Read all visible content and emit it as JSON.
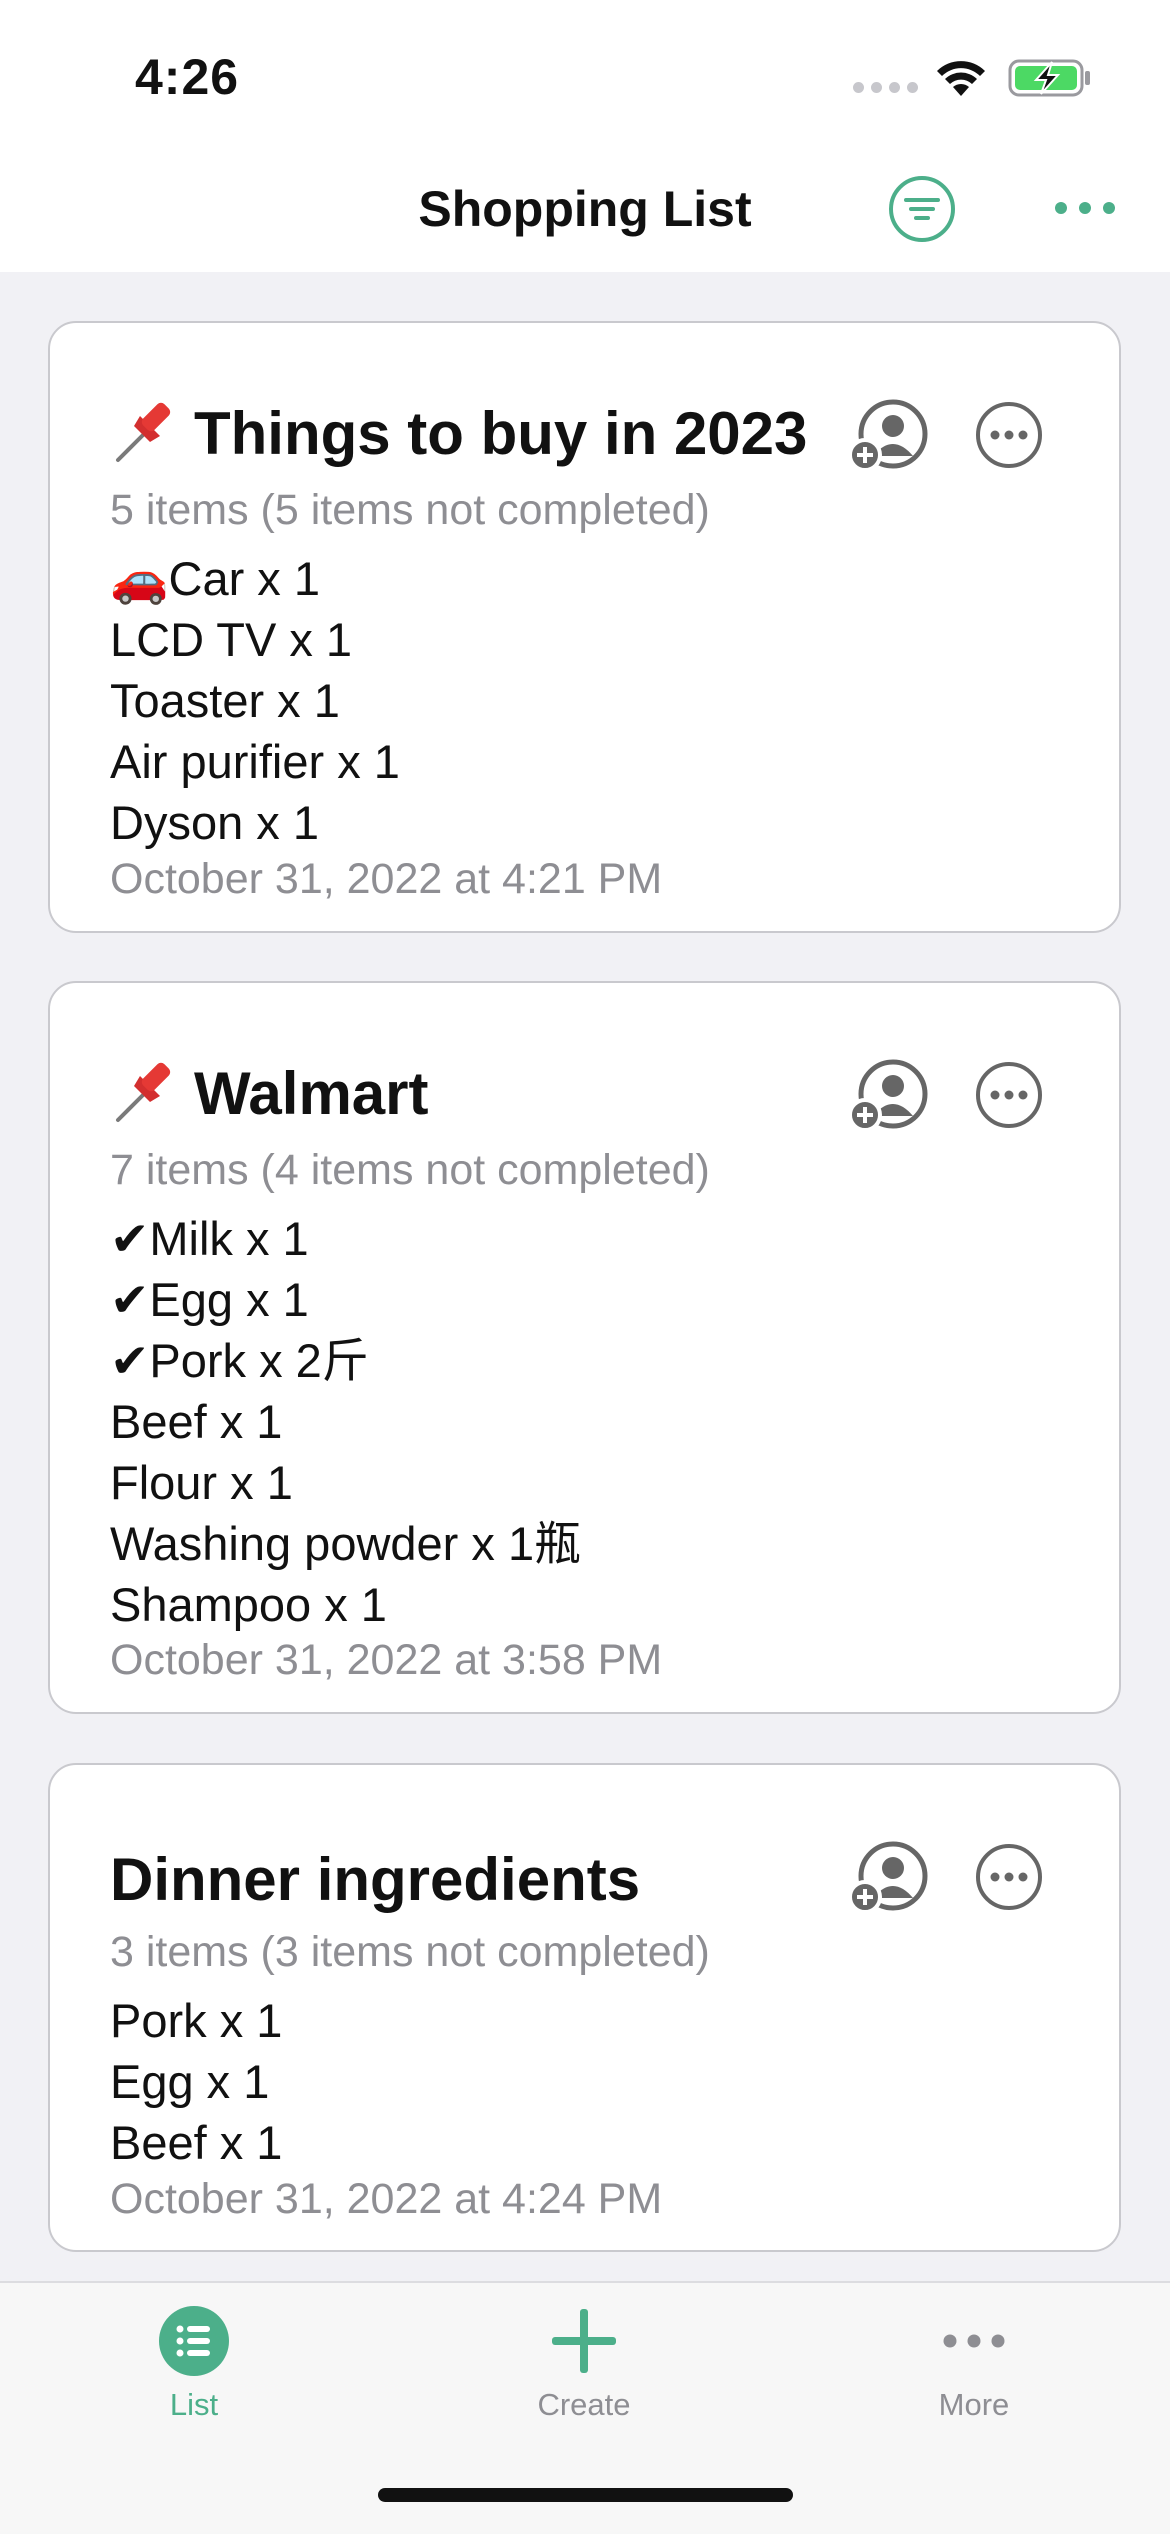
{
  "status_bar": {
    "time": "4:26"
  },
  "nav": {
    "title": "Shopping List"
  },
  "colors": {
    "accent": "#4caf8a",
    "muted": "#8e8e93",
    "card_border": "#c9c9ce"
  },
  "lists": [
    {
      "pinned": true,
      "title": "Things to buy in 2023",
      "summary": "5 items (5 items not completed)",
      "items": [
        "🚗Car x 1",
        "LCD TV x 1",
        "Toaster x 1",
        "Air purifier x 1",
        "Dyson x 1"
      ],
      "date": "October 31, 2022 at 4:21 PM"
    },
    {
      "pinned": true,
      "title": "Walmart",
      "summary": "7 items (4 items not completed)",
      "items": [
        "✔Milk x 1",
        "✔Egg x 1",
        "✔Pork x 2斤",
        "Beef x 1",
        "Flour x 1",
        "Washing powder x 1瓶",
        "Shampoo x 1"
      ],
      "date": "October 31, 2022 at 3:58 PM"
    },
    {
      "pinned": false,
      "title": "Dinner ingredients",
      "summary": "3 items (3 items not completed)",
      "items": [
        "Pork x 1",
        "Egg x 1",
        "Beef x 1"
      ],
      "date": "October 31, 2022 at 4:24 PM"
    }
  ],
  "tabs": [
    {
      "label": "List",
      "icon": "list-icon",
      "active": true
    },
    {
      "label": "Create",
      "icon": "plus-icon",
      "active": false
    },
    {
      "label": "More",
      "icon": "ellipsis-icon",
      "active": false
    }
  ]
}
